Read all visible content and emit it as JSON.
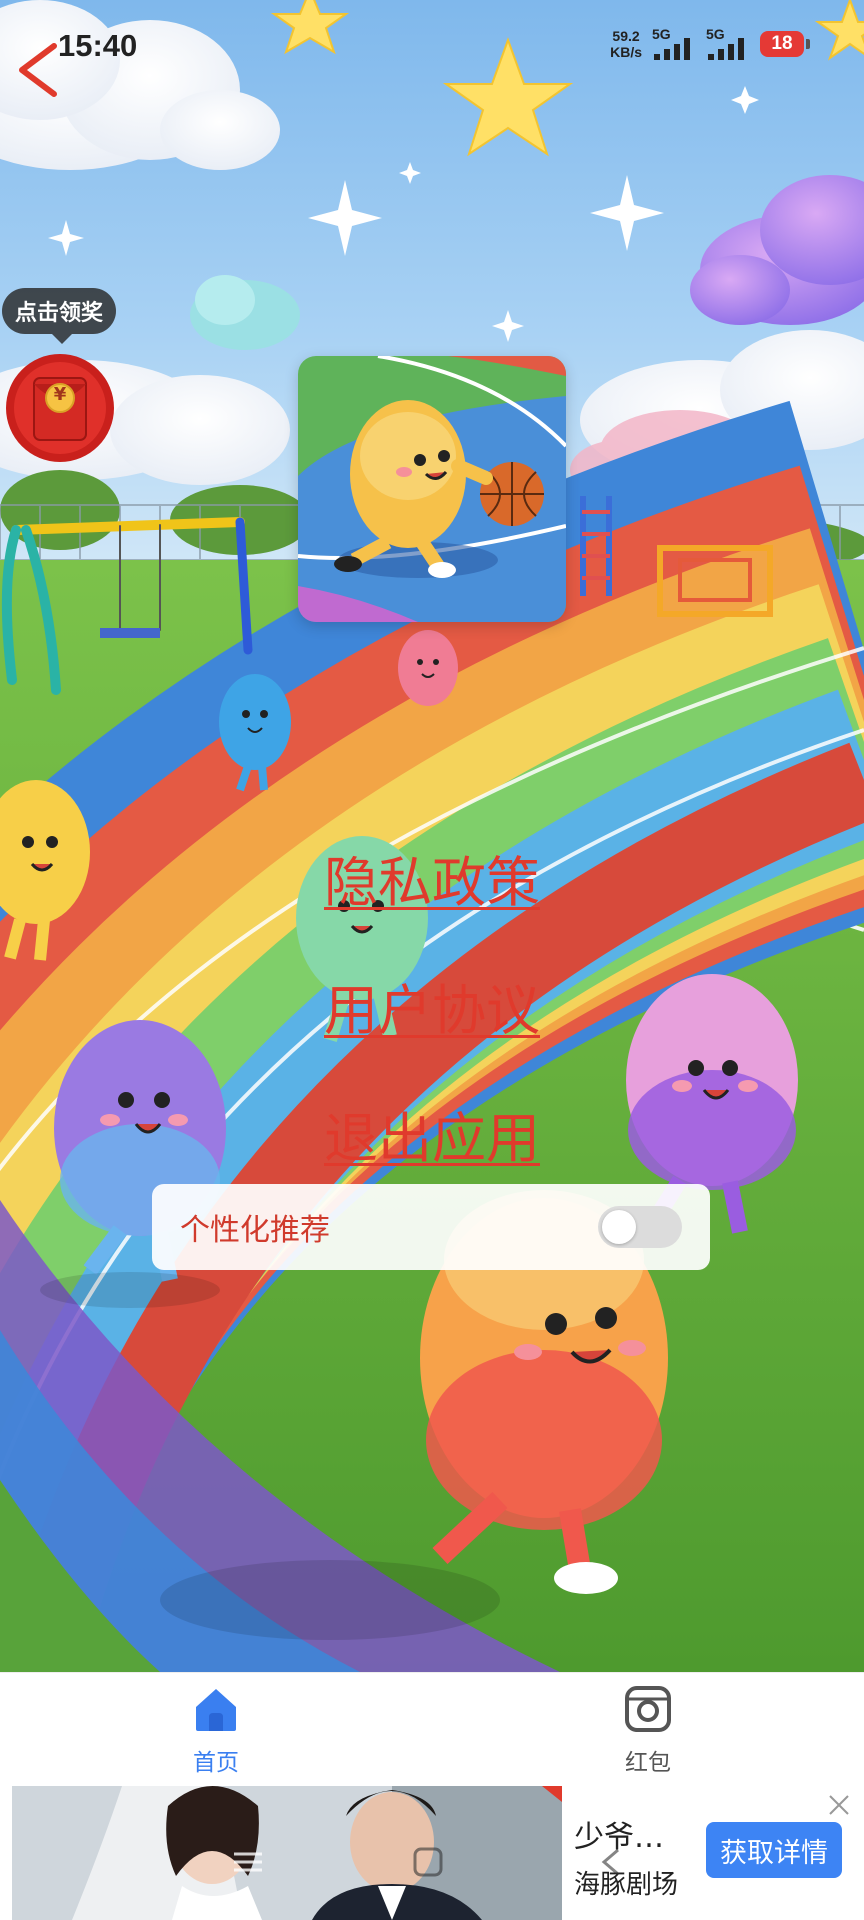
{
  "status_bar": {
    "time": "15:40",
    "net_speed_value": "59.2",
    "net_speed_unit": "KB/s",
    "signal_1_label": "5G",
    "signal_2_label": "5G",
    "battery": "18"
  },
  "reward": {
    "tooltip": "点击领奖",
    "coin_symbol": "¥"
  },
  "links": {
    "privacy_policy": "隐私政策",
    "user_agreement": "用户协议",
    "exit_app": "退出应用"
  },
  "settings": {
    "personalized_recommendation": "个性化推荐",
    "personalized_recommendation_enabled": false
  },
  "bottom_nav": {
    "items": [
      {
        "label": "首页",
        "icon": "home-icon",
        "active": true
      },
      {
        "label": "红包",
        "icon": "camera-icon",
        "active": false
      }
    ]
  },
  "ad": {
    "title": "少爷…",
    "subtitle": "海豚剧场",
    "cta": "获取详情",
    "close_icon": "close-icon"
  },
  "colors": {
    "link_red": "#e03a2c",
    "accent_blue": "#3a7ff0",
    "battery_red": "#e53935"
  }
}
